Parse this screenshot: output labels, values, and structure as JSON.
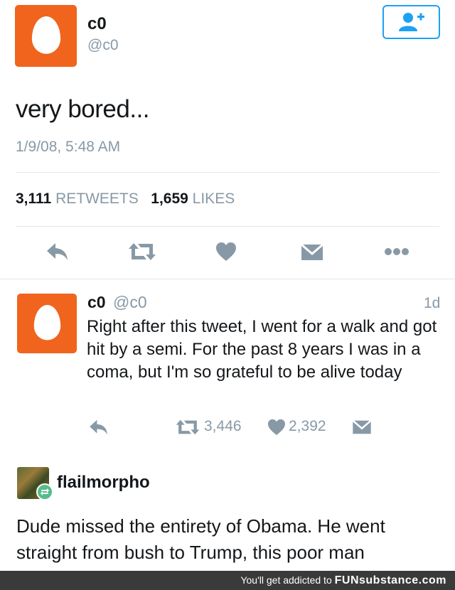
{
  "tweet": {
    "display_name": "c0",
    "handle": "@c0",
    "text": "very bored...",
    "timestamp": "1/9/08, 5:48 AM",
    "retweets_count": "3,111",
    "retweets_label": "RETWEETS",
    "likes_count": "1,659",
    "likes_label": "LIKES",
    "avatar_color": "#f0641e",
    "follow_icon": "add-user-icon",
    "actions": [
      "reply-icon",
      "retweet-icon",
      "heart-icon",
      "direct-message-icon",
      "more-icon"
    ]
  },
  "reply": {
    "display_name": "c0",
    "handle": "@c0",
    "time_ago": "1d",
    "text": "Right after this tweet, I went for a walk and got hit by a semi. For the past 8 years I was in a coma, but I'm so grateful to be alive today",
    "retweets": "3,446",
    "likes": "2,392"
  },
  "comment": {
    "username": "flailmorpho",
    "text": "Dude missed the entirety of Obama. He went straight from bush to Trump, this poor man"
  },
  "footer": {
    "tagline": "You'll get addicted to",
    "brand": "FUNsubstance.com"
  },
  "colors": {
    "accent": "#1da1f2",
    "muted_text": "#8899a6",
    "icon_gray": "#8899a6",
    "reblog_green": "#56bc8a"
  }
}
